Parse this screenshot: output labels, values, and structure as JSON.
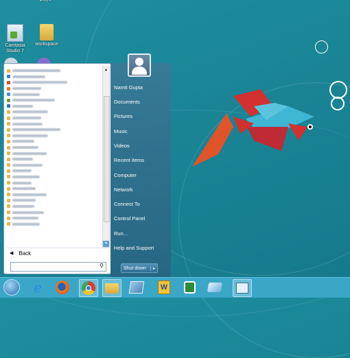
{
  "desktop": {
    "top_partial_label": "playe",
    "icons": [
      {
        "label_line1": "Camtasia",
        "label_line2": "Studio 7"
      },
      {
        "label_line1": "workspace",
        "label_line2": ""
      }
    ]
  },
  "start_menu": {
    "programs": [
      {
        "icon_color": "#e2b84a",
        "text_width": 70
      },
      {
        "icon_color": "#3a7fd0",
        "text_width": 48
      },
      {
        "icon_color": "#d24d2a",
        "text_width": 80
      },
      {
        "icon_color": "#e07a2a",
        "text_width": 42
      },
      {
        "icon_color": "#4a8ed8",
        "text_width": 40
      },
      {
        "icon_color": "#6a9e3a",
        "text_width": 62
      },
      {
        "icon_color": "#2c6fb8",
        "text_width": 30
      },
      {
        "icon_color": "#e2b84a",
        "text_width": 52
      },
      {
        "icon_color": "#e2b84a",
        "text_width": 42
      },
      {
        "icon_color": "#e2b84a",
        "text_width": 44
      },
      {
        "icon_color": "#e2b84a",
        "text_width": 70
      },
      {
        "icon_color": "#e2b84a",
        "text_width": 52
      },
      {
        "icon_color": "#e2b84a",
        "text_width": 32
      },
      {
        "icon_color": "#e2b84a",
        "text_width": 38
      },
      {
        "icon_color": "#e2b84a",
        "text_width": 50
      },
      {
        "icon_color": "#e2b84a",
        "text_width": 30
      },
      {
        "icon_color": "#e2b84a",
        "text_width": 44
      },
      {
        "icon_color": "#e2b84a",
        "text_width": 28
      },
      {
        "icon_color": "#e2b84a",
        "text_width": 40
      },
      {
        "icon_color": "#e2b84a",
        "text_width": 28
      },
      {
        "icon_color": "#e2b84a",
        "text_width": 34
      },
      {
        "icon_color": "#e2b84a",
        "text_width": 50
      },
      {
        "icon_color": "#e2b84a",
        "text_width": 34
      },
      {
        "icon_color": "#e2b84a",
        "text_width": 32
      },
      {
        "icon_color": "#e2b84a",
        "text_width": 46
      },
      {
        "icon_color": "#e2b84a",
        "text_width": 38
      },
      {
        "icon_color": "#e2b84a",
        "text_width": 40
      }
    ],
    "back_label": "Back",
    "search_placeholder": "",
    "user_name": "Namit Gupta",
    "right_items": [
      "Documents",
      "Pictures",
      "Music",
      "Videos",
      "Recent Items",
      "Computer",
      "Network",
      "Connect To",
      "Control Panel",
      "Run...",
      "Help and Support"
    ],
    "shutdown_label": "Shut down"
  },
  "taskbar": {
    "items": [
      {
        "name": "start-orb-icon",
        "active": false
      },
      {
        "name": "internet-explorer-icon",
        "active": false
      },
      {
        "name": "firefox-icon",
        "active": false
      },
      {
        "name": "chrome-icon",
        "active": true
      },
      {
        "name": "file-explorer-icon",
        "active": true
      },
      {
        "name": "window-app-icon",
        "active": false
      },
      {
        "name": "word-icon",
        "active": false
      },
      {
        "name": "green-app-icon",
        "active": false
      },
      {
        "name": "blue-app-icon",
        "active": false
      },
      {
        "name": "book-app-icon",
        "active": true
      }
    ]
  },
  "colors": {
    "fish_body": "#3fb6d4",
    "fish_red": "#d2312f",
    "fish_orange": "#e0542a"
  }
}
